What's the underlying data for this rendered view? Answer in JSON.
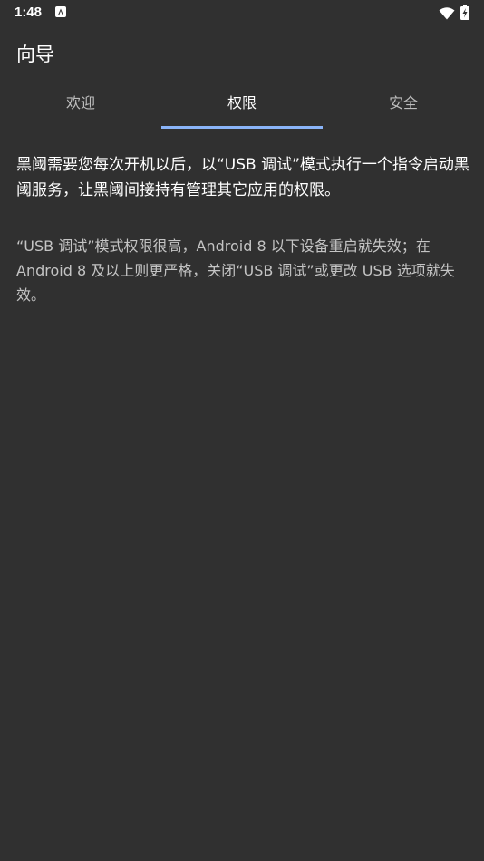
{
  "status_bar": {
    "time": "1:48",
    "icons": [
      "notification-a-icon",
      "wifi-icon",
      "battery-charging-icon"
    ]
  },
  "app_bar": {
    "title": "向导"
  },
  "tabs": [
    {
      "label": "欢迎",
      "active": false
    },
    {
      "label": "权限",
      "active": true
    },
    {
      "label": "安全",
      "active": false
    }
  ],
  "content": {
    "paragraph_main": "黑阈需要您每次开机以后，以“USB 调试”模式执行一个指令启动黑阈服务，让黑阈间接持有管理其它应用的权限。",
    "paragraph_note": "“USB 调试”模式权限很高，Android 8 以下设备重启就失效；在 Android 8 及以上则更严格，关闭“USB 调试”或更改 USB 选项就失效。"
  },
  "colors": {
    "background": "#303030",
    "accent": "#8ab4f8",
    "text_primary": "#ffffff",
    "text_secondary": "#c4c4c4"
  }
}
